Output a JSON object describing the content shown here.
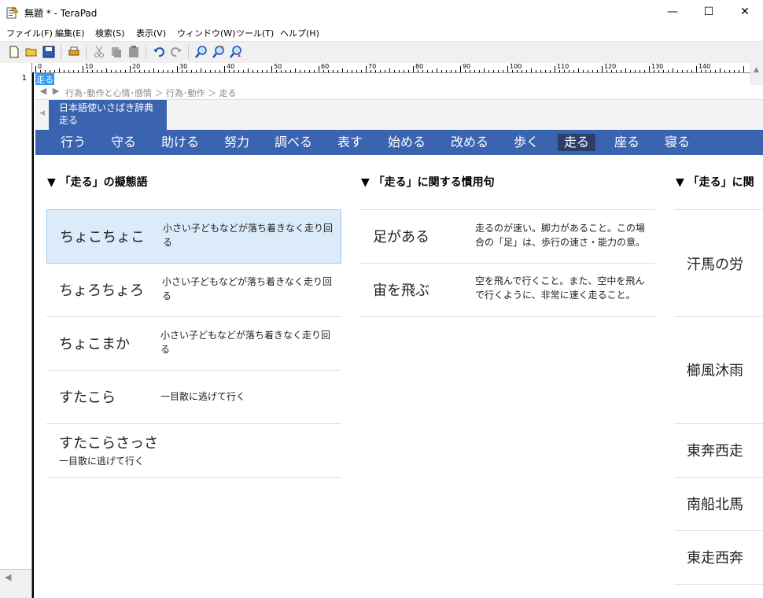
{
  "window": {
    "title": "無題 * - TeraPad",
    "minimize": "—",
    "maximize": "☐",
    "close": "✕"
  },
  "menu": [
    "ファイル(F)",
    "編集(E)",
    "検索(S)",
    "表示(V)",
    "ウィンドウ(W)",
    "ツール(T)",
    "ヘルプ(H)"
  ],
  "toolbar": {
    "buttons": [
      "new-file-icon",
      "open-folder-icon",
      "save-icon",
      "print-icon",
      "cut-icon",
      "copy-icon",
      "paste-icon",
      "undo-icon",
      "redo-icon",
      "find-icon",
      "find-next-icon",
      "find-prev-icon"
    ]
  },
  "ruler": {
    "labels": [
      "0",
      "10",
      "20",
      "30",
      "40",
      "50",
      "60",
      "70",
      "80",
      "90",
      "100",
      "110",
      "120",
      "130",
      "140"
    ]
  },
  "editor": {
    "line_number": "1",
    "selected_text": "走る"
  },
  "nav": {
    "back": "◀",
    "forward": "▶",
    "breadcrumb": "行為･動作と心情･感情 ＞ 行為･動作 ＞ 走る"
  },
  "tab": {
    "line1": "日本語使いさばき辞典",
    "line2": "走る"
  },
  "categories": [
    "行う",
    "守る",
    "助ける",
    "努力",
    "調べる",
    "表す",
    "始める",
    "改める",
    "歩く",
    "走る",
    "座る",
    "寝る"
  ],
  "active_category": "走る",
  "columns": [
    {
      "title": "▼ 「走る」の擬態語",
      "rows": [
        {
          "term": "ちょこちょこ",
          "desc": "小さい子どもなどが落ち着きなく走り回る"
        },
        {
          "term": "ちょろちょろ",
          "desc": "小さい子どもなどが落ち着きなく走り回る"
        },
        {
          "term": "ちょこまか",
          "desc": "小さい子どもなどが落ち着きなく走り回る"
        },
        {
          "term": "すたこら",
          "desc": "一目散に逃げて行く"
        },
        {
          "term": "すたこらさっさ",
          "desc": "一目散に逃げて行く"
        }
      ]
    },
    {
      "title": "▼ 「走る」に関する慣用句",
      "rows": [
        {
          "term": "足がある",
          "desc": "走るのが速い。脚力があること。この場合の「足」は、歩行の速さ・能力の意。"
        },
        {
          "term": "宙を飛ぶ",
          "desc": "空を飛んで行くこと。また、空中を飛んで行くように、非常に速く走ること。"
        }
      ]
    },
    {
      "title": "▼ 「走る」に関",
      "rows": [
        {
          "term": "汗馬の労"
        },
        {
          "term": "櫛風沐雨"
        },
        {
          "term": "東奔西走"
        },
        {
          "term": "南船北馬"
        },
        {
          "term": "東走西奔"
        }
      ]
    }
  ],
  "colors": {
    "accent": "#3a63b0",
    "active_tab": "#2c3e6a",
    "highlight": "#dcebfa",
    "selection": "#3399ff"
  }
}
